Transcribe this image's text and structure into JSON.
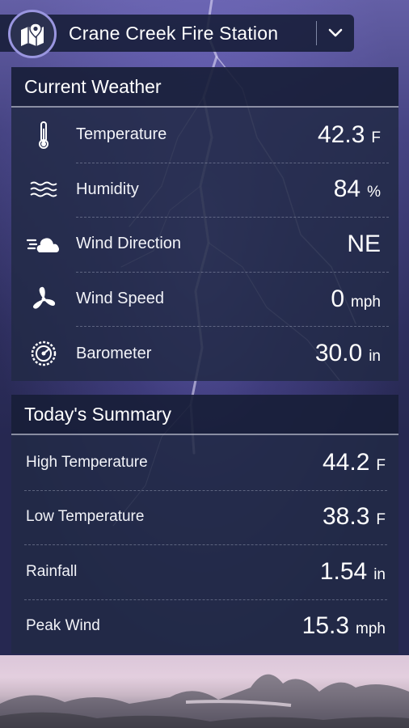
{
  "header": {
    "station_name": "Crane Creek Fire Station",
    "logo_icon": "map-pin-icon",
    "dropdown_icon": "chevron-down-icon"
  },
  "current": {
    "title": "Current Weather",
    "rows": [
      {
        "label": "Temperature",
        "value": "42.3",
        "unit": "F",
        "icon": "thermometer-icon"
      },
      {
        "label": "Humidity",
        "value": "84",
        "unit": "%",
        "icon": "humidity-waves-icon"
      },
      {
        "label": "Wind Direction",
        "value": "NE",
        "unit": "",
        "icon": "wind-cloud-icon"
      },
      {
        "label": "Wind Speed",
        "value": "0",
        "unit": "mph",
        "icon": "fan-icon"
      },
      {
        "label": "Barometer",
        "value": "30.0",
        "unit": "in",
        "icon": "gauge-icon"
      }
    ]
  },
  "summary": {
    "title": "Today's Summary",
    "rows": [
      {
        "label": "High Temperature",
        "value": "44.2",
        "unit": "F"
      },
      {
        "label": "Low Temperature",
        "value": "38.3",
        "unit": "F"
      },
      {
        "label": "Rainfall",
        "value": "1.54",
        "unit": "in"
      },
      {
        "label": "Peak Wind",
        "value": "15.3",
        "unit": "mph"
      }
    ]
  },
  "colors": {
    "panel_header": "#181e38",
    "panel_body": "#222a46",
    "accent": "#9a96e0"
  }
}
